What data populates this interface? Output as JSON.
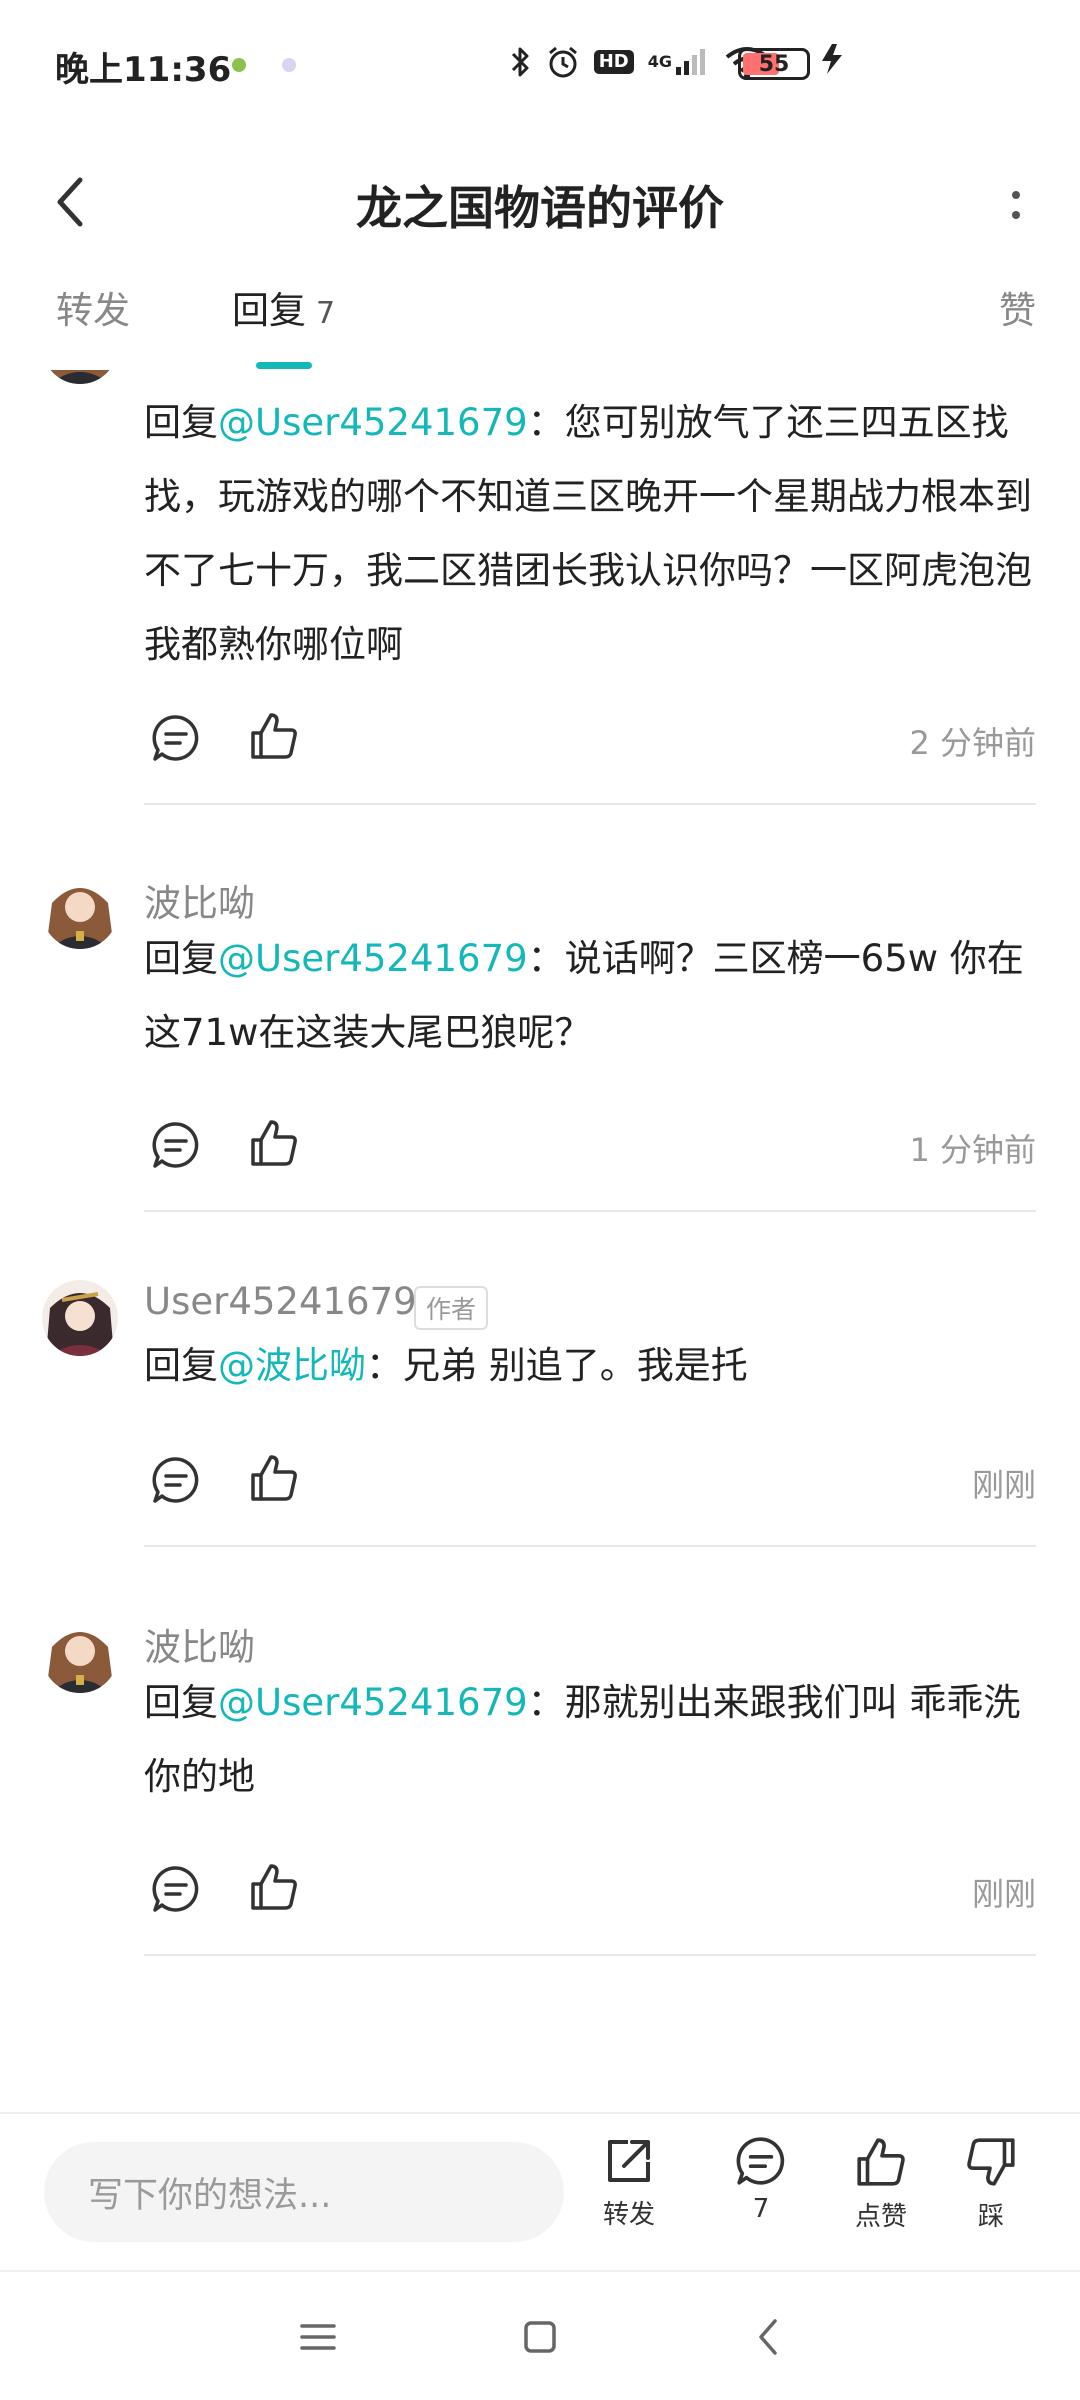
{
  "status_bar": {
    "time": "晚上11:36",
    "hd": "HD",
    "network": "4G",
    "battery": "55",
    "colors": {
      "dot1": "#8bc34a",
      "dot2": "#d9d4f0"
    }
  },
  "header": {
    "title": "龙之国物语的评价"
  },
  "tabs": {
    "repost": "转发",
    "reply": "回复",
    "reply_count": "7",
    "like": "赞"
  },
  "comments": [
    {
      "username": "",
      "reply_prefix": "回复",
      "mention": "@User45241679",
      "separator": "：",
      "text": "您可别放气了还三四五区找找，玩游戏的哪个不知道三区晚开一个星期战力根本到不了七十万，我二区猎团长我认识你吗？一区阿虎泡泡我都熟你哪位啊",
      "time": "2 分钟前"
    },
    {
      "username": "波比呦",
      "reply_prefix": "回复",
      "mention": "@User45241679",
      "separator": "：",
      "text": "说话啊？三区榜一65w 你在这71w在这装大尾巴狼呢？",
      "time": "1 分钟前"
    },
    {
      "username": "User45241679",
      "author_tag": "作者",
      "reply_prefix": "回复",
      "mention": "@波比呦",
      "separator": "：",
      "text": "兄弟 别追了。我是托",
      "time": "刚刚"
    },
    {
      "username": "波比呦",
      "reply_prefix": "回复",
      "mention": "@User45241679",
      "separator": "：",
      "text": "那就别出来跟我们叫 乖乖洗你的地",
      "time": "刚刚"
    }
  ],
  "bottom_bar": {
    "input_placeholder": "写下你的想法...",
    "repost_label": "转发",
    "comment_count": "7",
    "like_label": "点赞",
    "dislike_label": "踩"
  },
  "icons": {
    "back": "chevron-left-icon",
    "more": "more-vertical-icon",
    "comment": "comment-bubble-icon",
    "like": "thumbs-up-icon",
    "dislike": "thumbs-down-icon",
    "share": "share-icon"
  },
  "colors": {
    "accent": "#14b8b8",
    "text_primary": "#222222",
    "text_secondary": "#888888",
    "divider": "#e8e8e8"
  }
}
